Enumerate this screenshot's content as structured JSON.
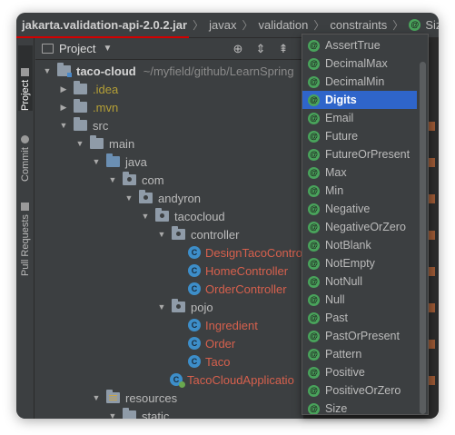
{
  "breadcrumb": [
    {
      "label": "jakarta.validation-api-2.0.2.jar"
    },
    {
      "label": "javax"
    },
    {
      "label": "validation"
    },
    {
      "label": "constraints"
    },
    {
      "label": "Size",
      "icon": "annotation-icon"
    }
  ],
  "toolstrip": {
    "project_label": "Project",
    "commit_label": "Commit",
    "pull_requests_label": "Pull Requests"
  },
  "panel": {
    "title": "Project",
    "buttons": [
      "locate-icon",
      "expand-all-icon",
      "collapse-all-icon",
      "settings-icon"
    ]
  },
  "tree": [
    {
      "label": "taco-cloud",
      "path": "~/myfield/github/LearnSpring"
    },
    {
      "label": ".idea"
    },
    {
      "label": ".mvn"
    },
    {
      "label": "src"
    },
    {
      "label": "main"
    },
    {
      "label": "java"
    },
    {
      "label": "com"
    },
    {
      "label": "andyron"
    },
    {
      "label": "tacocloud"
    },
    {
      "label": "controller"
    },
    {
      "label": "DesignTacoContro"
    },
    {
      "label": "HomeController"
    },
    {
      "label": "OrderController"
    },
    {
      "label": "pojo"
    },
    {
      "label": "Ingredient"
    },
    {
      "label": "Order"
    },
    {
      "label": "Taco"
    },
    {
      "label": "TacoCloudApplicatio"
    },
    {
      "label": "resources"
    },
    {
      "label": "static"
    }
  ],
  "popup": {
    "selected_index": 3,
    "items": [
      "AssertTrue",
      "DecimalMax",
      "DecimalMin",
      "Digits",
      "Email",
      "Future",
      "FutureOrPresent",
      "Max",
      "Min",
      "Negative",
      "NegativeOrZero",
      "NotBlank",
      "NotEmpty",
      "NotNull",
      "Null",
      "Past",
      "PastOrPresent",
      "Pattern",
      "Positive",
      "PositiveOrZero",
      "Size"
    ]
  },
  "colors": {
    "background": "#3c3f41",
    "selection": "#2f65ca",
    "annotation_icon": "#49a35b",
    "class_icon": "#3d8ec9",
    "class_label": "#d6604d",
    "excluded_label": "#b5a036",
    "underline": "#d40000"
  }
}
